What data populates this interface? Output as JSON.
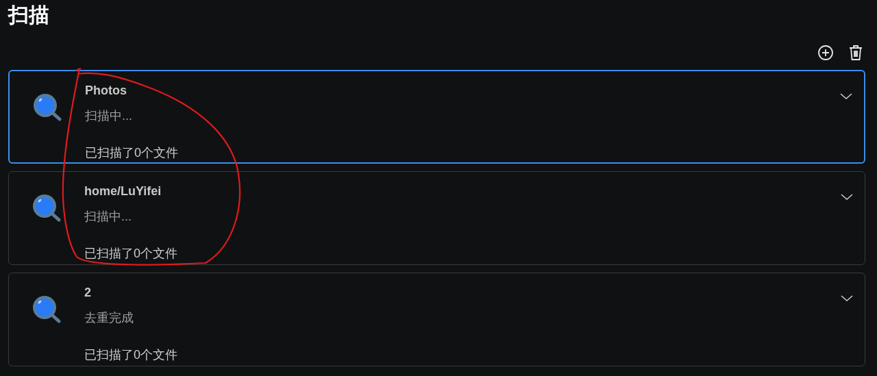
{
  "page": {
    "title": "扫描"
  },
  "toolbar": [
    {
      "kind": "add"
    },
    {
      "kind": "delete"
    }
  ],
  "tasks": [
    {
      "name": "Photos",
      "status": "扫描中...",
      "count": "已扫描了0个文件",
      "selected": true
    },
    {
      "name": "home/LuYifei",
      "status": "扫描中...",
      "count": "已扫描了0个文件",
      "selected": false
    },
    {
      "name": "2",
      "status": "去重完成",
      "count": "已扫描了0个文件",
      "selected": false
    }
  ]
}
